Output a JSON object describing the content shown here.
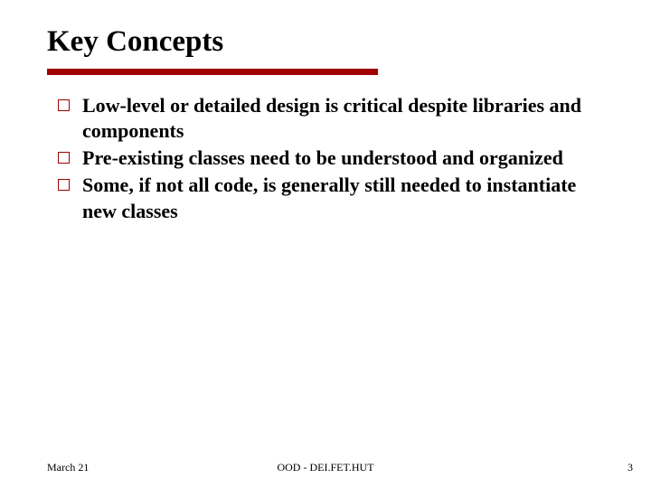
{
  "title": "Key Concepts",
  "bullets": [
    "Low-level or detailed design is critical despite libraries and components",
    "Pre-existing classes need to be understood and organized",
    "Some, if not all code, is generally still needed to instantiate new classes"
  ],
  "footer": {
    "date": "March 21",
    "center": "OOD - DEI.FET.HUT",
    "page": "3"
  }
}
